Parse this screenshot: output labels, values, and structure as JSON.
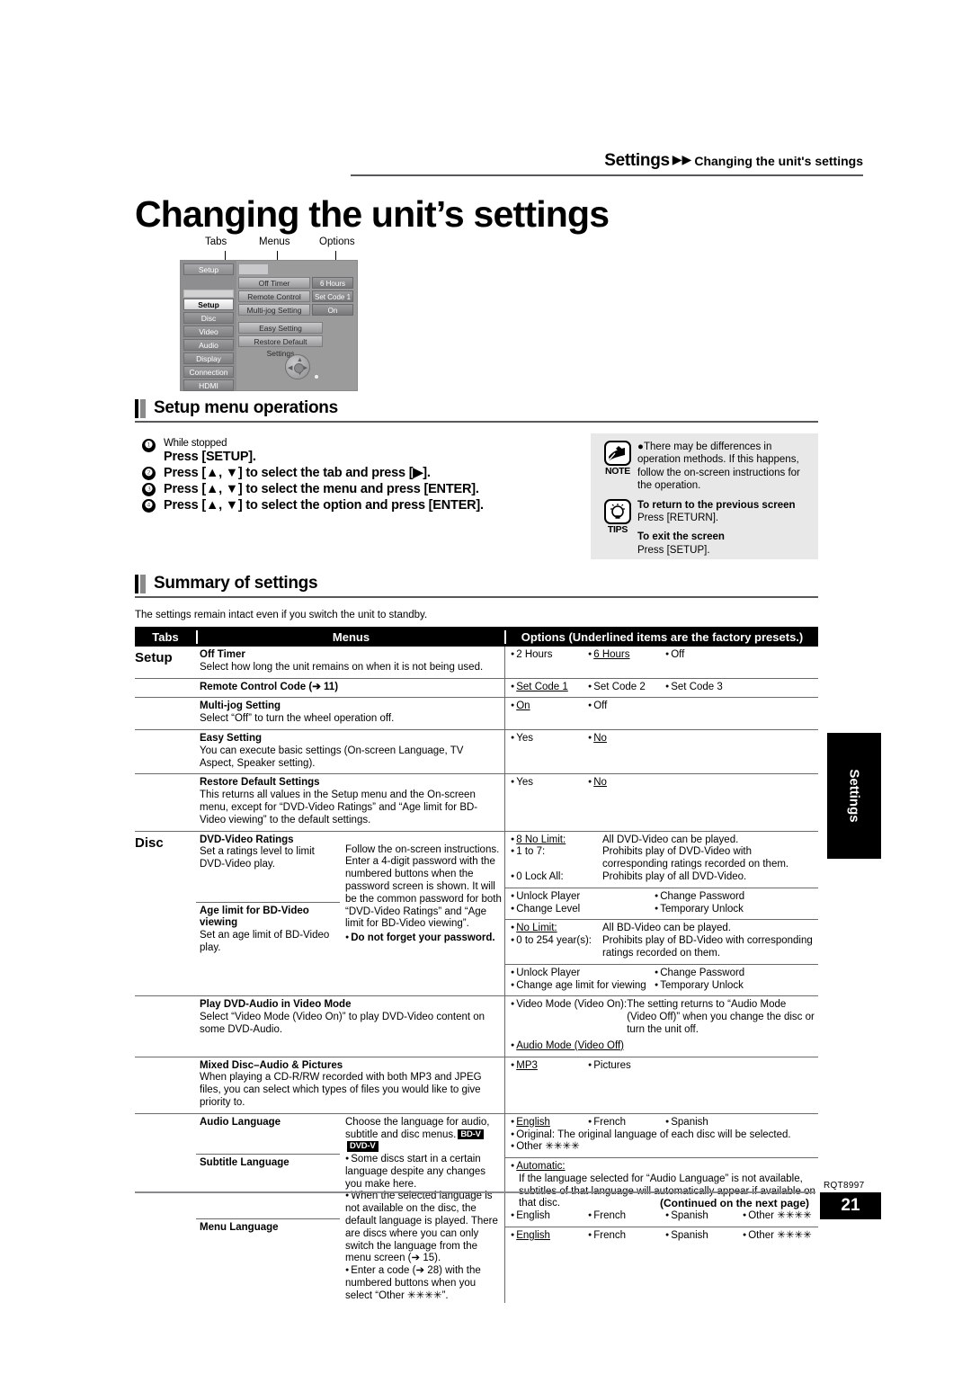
{
  "header": {
    "breadcrumb_main": "Settings",
    "arrows": "▶▶",
    "breadcrumb_sub": "Changing the unit's settings"
  },
  "page_title": "Changing the unit’s settings",
  "osd_callouts": {
    "tabs": "Tabs",
    "menus": "Menus",
    "options": "Options"
  },
  "osd": {
    "header_tab": "Setup",
    "tabs": [
      "Setup",
      "Disc",
      "Video",
      "Audio",
      "Display",
      "Connection",
      "HDMI"
    ],
    "rows": [
      {
        "name": "Off Timer",
        "value": "6 Hours"
      },
      {
        "name": "Remote Control Code",
        "value": "Set Code 1"
      },
      {
        "name": "Multi-jog Setting",
        "value": "On"
      }
    ],
    "buttons": [
      "Easy Setting",
      "Restore Default Settings"
    ]
  },
  "sections": {
    "setup_ops": "Setup menu operations",
    "summary": "Summary of settings"
  },
  "steps": [
    {
      "num": "❶",
      "pre": "While stopped",
      "text": "Press [SETUP]."
    },
    {
      "num": "❷",
      "pre": "",
      "text": "Press [▲, ▼] to select the tab and press [▶]."
    },
    {
      "num": "❸",
      "pre": "",
      "text": "Press [▲, ▼] to select the menu and press [ENTER]."
    },
    {
      "num": "❹",
      "pre": "",
      "text": "Press [▲, ▼] to select the option and press [ENTER]."
    }
  ],
  "notebox": {
    "note_label": "NOTE",
    "note_text": "There may be differences in operation methods. If this happens, follow the on-screen instructions for the operation.",
    "tips_label": "TIPS",
    "tips": [
      {
        "title": "To return to the previous screen",
        "body": "Press [RETURN]."
      },
      {
        "title": "To exit the screen",
        "body": "Press [SETUP]."
      }
    ]
  },
  "summary_intro": "The settings remain intact even if you switch the unit to standby.",
  "table": {
    "headers": {
      "tabs": "Tabs",
      "menus": "Menus",
      "options": "Options (Underlined items are the factory presets.)"
    },
    "setup": {
      "tab_label": "Setup",
      "rows": [
        {
          "title": "Off Timer",
          "desc": "Select how long the unit remains on when it is not being used.",
          "options": [
            "2 Hours",
            "6 Hours",
            "Off"
          ],
          "underlined": [
            "6 Hours"
          ]
        },
        {
          "title": "Remote Control Code (➔ 11)",
          "desc": "",
          "options": [
            "Set Code 1",
            "Set Code 2",
            "Set Code 3"
          ],
          "underlined": [
            "Set Code 1"
          ]
        },
        {
          "title": "Multi-jog Setting",
          "desc": "Select “Off” to turn the wheel operation off.",
          "options": [
            "On",
            "Off"
          ],
          "underlined": [
            "On"
          ]
        },
        {
          "title": "Easy Setting",
          "desc": "You can execute basic settings (On-screen Language, TV Aspect, Speaker setting).",
          "options": [
            "Yes",
            "No"
          ],
          "underlined": [
            "No"
          ]
        },
        {
          "title": "Restore Default Settings",
          "desc": "This returns all values in the Setup menu and the On-screen menu, except for “DVD-Video Ratings” and “Age limit for BD-Video viewing” to the default settings.",
          "options": [
            "Yes",
            "No"
          ],
          "underlined": [
            "No"
          ]
        }
      ]
    },
    "disc": {
      "tab_label": "Disc",
      "ratings": {
        "shared_note": "Follow the on-screen instructions. Enter a 4-digit password with the numbered buttons when the password screen is shown. It will be the common password for both “DVD-Video Ratings” and “Age limit for BD-Video viewing”.",
        "shared_warning": "Do not forget your password.",
        "dvd": {
          "title": "DVD-Video Ratings",
          "desc": "Set a ratings level to limit DVD-Video play.",
          "levels": [
            {
              "label": "8 No Limit:",
              "underlined": true,
              "text": "All DVD-Video can be played."
            },
            {
              "label": "1 to 7:",
              "underlined": false,
              "text": "Prohibits play of DVD-Video with corresponding ratings recorded on them."
            },
            {
              "label": "0 Lock All:",
              "underlined": false,
              "text": "Prohibits play of all DVD-Video."
            }
          ],
          "actions": [
            "Unlock Player",
            "Change Password",
            "Change Level",
            "Temporary Unlock"
          ]
        },
        "bd": {
          "title": "Age limit for BD-Video viewing",
          "desc": "Set an age limit of BD-Video play.",
          "levels": [
            {
              "label": "No Limit:",
              "underlined": true,
              "text": "All BD-Video can be played."
            },
            {
              "label": "0 to 254 year(s):",
              "underlined": false,
              "text": "Prohibits play of BD-Video with corresponding ratings recorded on them."
            }
          ],
          "actions": [
            "Unlock Player",
            "Change Password",
            "Change age limit for viewing",
            "Temporary Unlock"
          ]
        }
      },
      "play_dvd_audio": {
        "title": "Play DVD-Audio in Video Mode",
        "desc": "Select “Video Mode (Video On)” to play DVD-Video content on some DVD-Audio.",
        "opt1_label": "Video Mode (Video On):",
        "opt1_text": "The setting returns to “Audio Mode (Video Off)” when you change the disc or turn the unit off.",
        "opt2_label": "Audio Mode (Video Off)"
      },
      "mixed_disc": {
        "title": "Mixed Disc–Audio & Pictures",
        "desc": "When playing a CD-R/RW recorded with both MP3 and JPEG files, you can select which types of files you would like to give priority to.",
        "options": [
          "MP3",
          "Pictures"
        ],
        "underlined": [
          "MP3"
        ]
      },
      "languages": {
        "shared_desc_head": "Choose the language for audio, subtitle and disc menus.",
        "badges": [
          "BD-V",
          "DVD-V"
        ],
        "shared_bullets": [
          "Some discs start in a certain language despite any changes you make here.",
          "When the selected language is not available on the disc, the default language is played. There are discs where you can only switch the language from the menu screen (➔ 15).",
          "Enter a code (➔ 28) with the numbered buttons when you select “Other ✳✳✳✳”."
        ],
        "audio": {
          "title": "Audio Language",
          "options": [
            "English",
            "French",
            "Spanish"
          ],
          "underlined": [
            "English"
          ],
          "original_label": "Original:",
          "original_text": "The original language of each disc will be selected.",
          "other": "Other ✳✳✳✳"
        },
        "subtitle": {
          "title": "Subtitle Language",
          "automatic_label": "Automatic:",
          "automatic_text": "If the language selected for “Audio Language” is not available, subtitles of that language will automatically appear if available on that disc.",
          "options": [
            "English",
            "French",
            "Spanish",
            "Other ✳✳✳✳"
          ],
          "underlined": [
            "Automatic"
          ]
        },
        "menu": {
          "title": "Menu Language",
          "options": [
            "English",
            "French",
            "Spanish",
            "Other ✳✳✳✳"
          ],
          "underlined": [
            "English"
          ]
        }
      }
    }
  },
  "side_tab": "Settings",
  "footer": {
    "continued": "(Continued on the next page)",
    "model_code": "RQT8997",
    "page_number": "21"
  }
}
